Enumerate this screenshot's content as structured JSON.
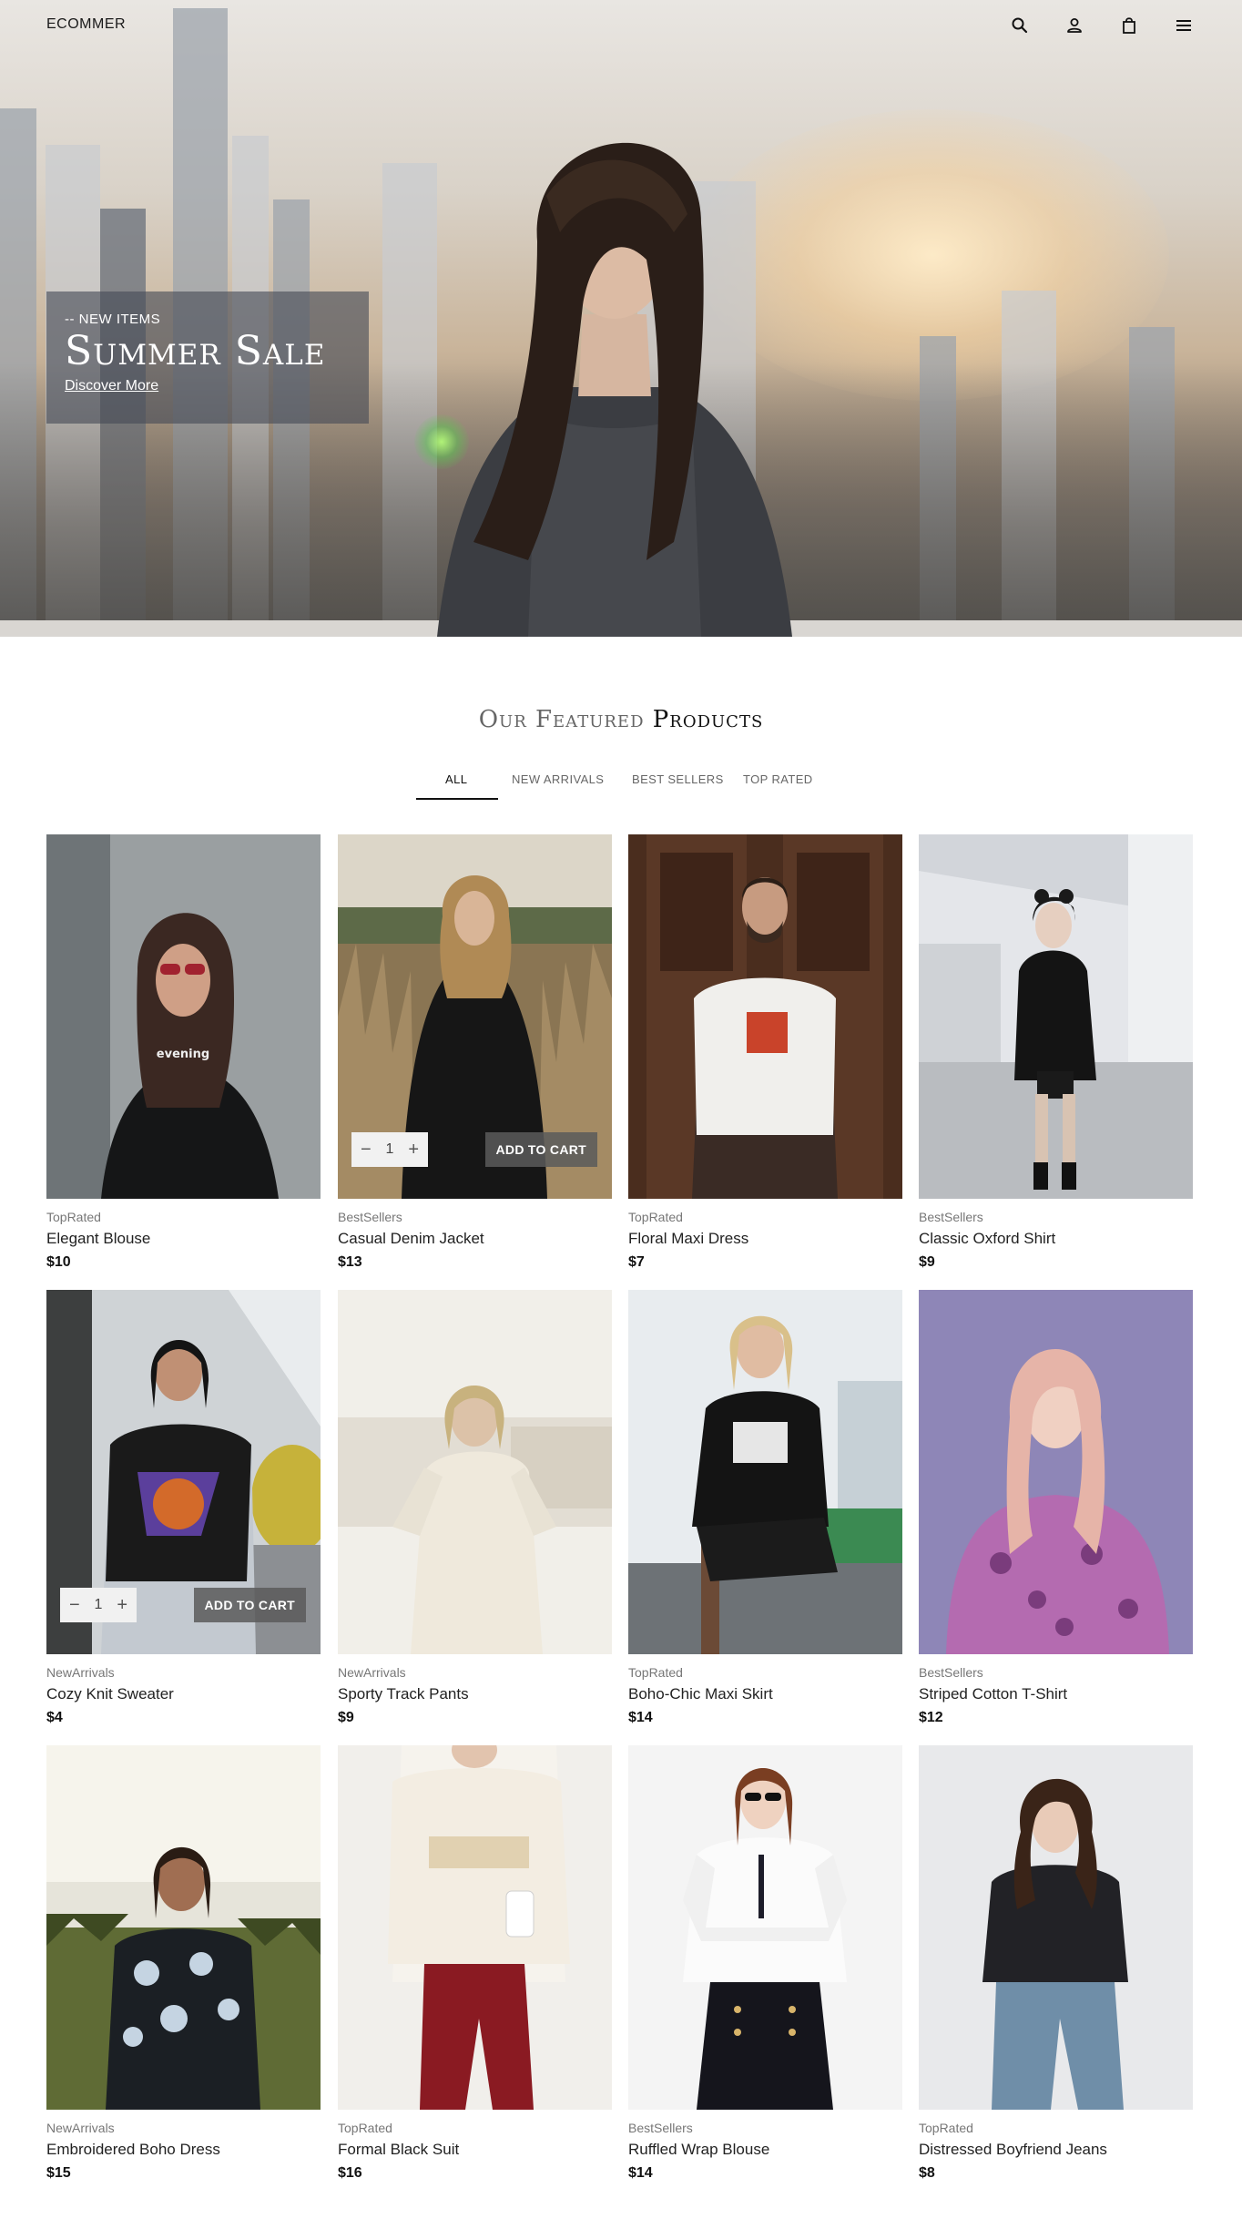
{
  "header": {
    "brand": "ECOMMER",
    "icons": [
      "search-icon",
      "user-icon",
      "shopping-bag-icon",
      "menu-icon"
    ]
  },
  "hero": {
    "kicker": "-- NEW ITEMS",
    "headline": "Summer Sale",
    "link": "Discover More"
  },
  "featured": {
    "title_light": "Our Featured",
    "title_bold": "Products",
    "tabs": [
      {
        "label": "ALL",
        "active": true
      },
      {
        "label": "NEW ARRIVALS",
        "active": false
      },
      {
        "label": "BEST SELLERS",
        "active": false
      },
      {
        "label": "TOP RATED",
        "active": false
      }
    ]
  },
  "cart_controls": {
    "qty": "1",
    "minus": "−",
    "plus": "+",
    "add_label": "ADD TO CART"
  },
  "products": [
    {
      "category": "TopRated",
      "name": "Elegant Blouse",
      "price": "$10"
    },
    {
      "category": "BestSellers",
      "name": "Casual Denim Jacket",
      "price": "$13"
    },
    {
      "category": "TopRated",
      "name": "Floral Maxi Dress",
      "price": "$7"
    },
    {
      "category": "BestSellers",
      "name": "Classic Oxford Shirt",
      "price": "$9"
    },
    {
      "category": "NewArrivals",
      "name": "Cozy Knit Sweater",
      "price": "$4"
    },
    {
      "category": "NewArrivals",
      "name": "Sporty Track Pants",
      "price": "$9"
    },
    {
      "category": "TopRated",
      "name": "Boho-Chic Maxi Skirt",
      "price": "$14"
    },
    {
      "category": "BestSellers",
      "name": "Striped Cotton T-Shirt",
      "price": "$12"
    },
    {
      "category": "NewArrivals",
      "name": "Embroidered Boho Dress",
      "price": "$15"
    },
    {
      "category": "TopRated",
      "name": "Formal Black Suit",
      "price": "$16"
    },
    {
      "category": "BestSellers",
      "name": "Ruffled Wrap Blouse",
      "price": "$14"
    },
    {
      "category": "TopRated",
      "name": "Distressed Boyfriend Jeans",
      "price": "$8"
    }
  ]
}
